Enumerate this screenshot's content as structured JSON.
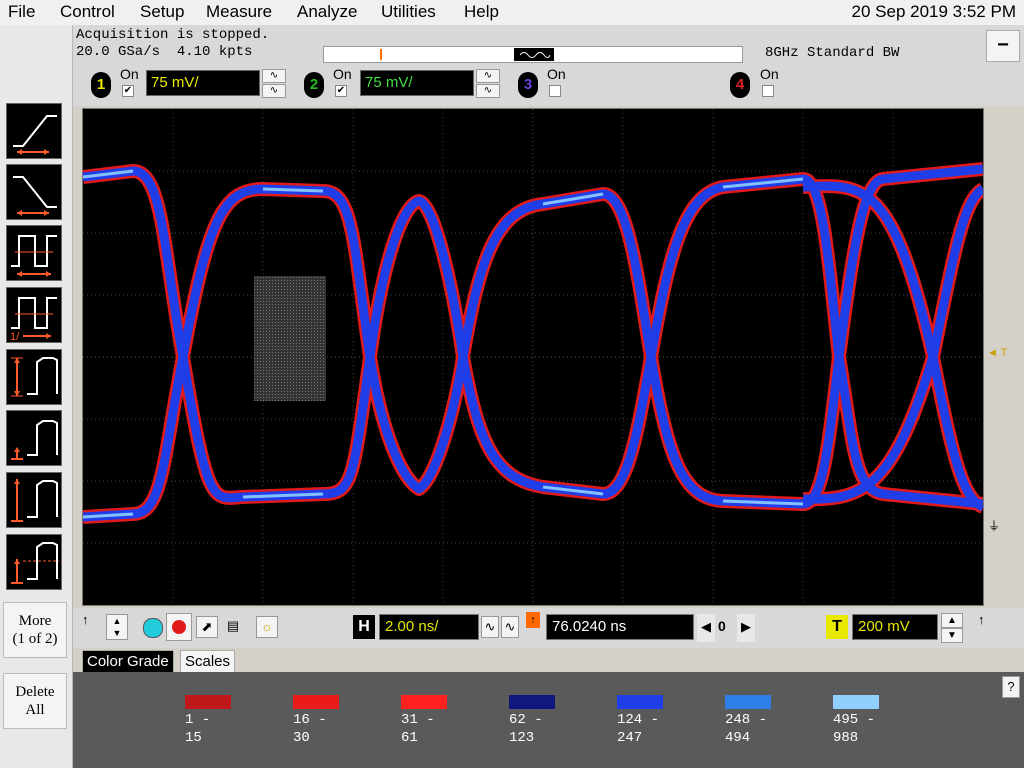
{
  "menu": {
    "items": [
      "File",
      "Control",
      "Setup",
      "Measure",
      "Analyze",
      "Utilities",
      "Help"
    ],
    "datetime": "20 Sep 2019  3:52 PM"
  },
  "status": {
    "acquisition": "Acquisition is stopped.",
    "sample_rate": "20.0 GSa/s",
    "points": "4.10 kpts",
    "bandwidth": "8GHz Standard BW"
  },
  "channels": [
    {
      "number": "1",
      "on_label": "On",
      "checked": "✔",
      "scale": "75 mV/",
      "color": "#ffff00",
      "badge_color": "#e8e800"
    },
    {
      "number": "2",
      "on_label": "On",
      "checked": "✔",
      "scale": "75 mV/",
      "color": "#44dd44",
      "badge_color": "#22bb22"
    },
    {
      "number": "3",
      "on_label": "On",
      "checked": "",
      "color": "#7a4cff",
      "badge_color": "#6644dd"
    },
    {
      "number": "4",
      "on_label": "On",
      "checked": "",
      "color": "#ff3b3b",
      "badge_color": "#dd2222"
    }
  ],
  "left_buttons": {
    "more_line1": "More",
    "more_line2": "(1 of 2)",
    "delete_line1": "Delete",
    "delete_line2": "All"
  },
  "screen_markers": {
    "trigger_label": "T",
    "trigger_arrow": "◄"
  },
  "controls": {
    "horizontal_label": "H",
    "time_scale": "2.00 ns/",
    "delay": "76.0240 ns",
    "nav_value": "0",
    "trigger_label": "T",
    "trigger_level": "200 mV"
  },
  "tabs": [
    "Color Grade",
    "Scales"
  ],
  "color_grade": [
    {
      "low": "1",
      "high": "15",
      "color": "#c01818"
    },
    {
      "low": "16",
      "high": "30",
      "color": "#ea1a1a"
    },
    {
      "low": "31",
      "high": "61",
      "color": "#ff2020"
    },
    {
      "low": "62",
      "high": "123",
      "color": "#101880"
    },
    {
      "low": "124",
      "high": "247",
      "color": "#1f3ee8"
    },
    {
      "low": "248",
      "high": "494",
      "color": "#2e7ee8"
    },
    {
      "low": "495",
      "high": "988",
      "color": "#8fd0ff"
    }
  ],
  "help_label": "?"
}
